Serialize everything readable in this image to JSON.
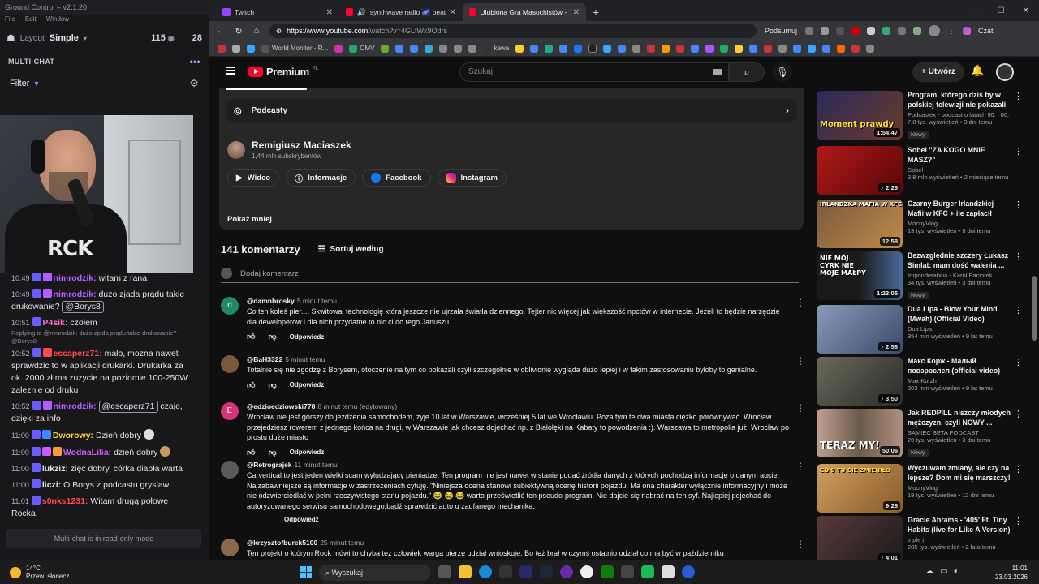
{
  "groundcontrol": {
    "title": "Ground Control – v2.1.20",
    "menu": [
      "File",
      "Edit",
      "Window"
    ],
    "layout_label": "Layout",
    "layout_value": "Simple",
    "viewers": "115",
    "count2": "28",
    "section_title": "MULTI-CHAT",
    "filter_label": "Filter",
    "shirt_text": "RCK",
    "messages": [
      {
        "time": "10:49",
        "nick": "nimrodzik:",
        "nick_color": "#b45cff",
        "text": "witam z rana"
      },
      {
        "time": "10:49",
        "nick": "nimrodzik:",
        "nick_color": "#b45cff",
        "text": "dużo zjada prądu takie drukowanie?",
        "mention": "@Borys8"
      },
      {
        "time": "10:51",
        "nick": "P4sik:",
        "nick_color": "#ff6ad5",
        "text": "czołem",
        "reply": "Replying to @nimrodzik: dużo zjada prądu takie drukowanie? @Borys8"
      },
      {
        "time": "10:52",
        "nick": "escaperz71:",
        "nick_color": "#ff4a4a",
        "text": "mało, mozna nawet sprawdzic to w aplikacji drukarki. Drukarka za ok. 2000 zł ma zuzycie na poziomie 100-250W zaleznie od druku"
      },
      {
        "time": "10:52",
        "nick": "nimrodzik:",
        "nick_color": "#b45cff",
        "mention": "@escaperz71",
        "text": "czaje, dzięki za info"
      },
      {
        "time": "11:00",
        "nick": "Dworowy:",
        "nick_color": "#ffd23f",
        "text": "Dzień dobry"
      },
      {
        "time": "11:00",
        "nick": "WodnaLilia:",
        "nick_color": "#c85cff",
        "text": "dzień dobry"
      },
      {
        "time": "11:00",
        "nick": "lukziz:",
        "nick_color": "#e6e6ea",
        "text": "zięć dobry, córka diabła warta"
      },
      {
        "time": "11:00",
        "nick": "liczi:",
        "nick_color": "#e6e6ea",
        "text": "O Borys z podcastu gryslaw"
      },
      {
        "time": "11:01",
        "nick": "s0nks1231:",
        "nick_color": "#ff4a4a",
        "text": "Witam drugą połowę Rocka."
      }
    ],
    "readonly": "Multi-chat is in read-only mode"
  },
  "browser": {
    "tabs": [
      {
        "title": "Twitch",
        "color": "#9146ff"
      },
      {
        "title": "synthwave radio 🌌 beats to",
        "color": "#ff0033"
      },
      {
        "title": "Ulubiona Gra Masochistów - YouT",
        "color": "#ff0033",
        "active": true
      }
    ],
    "url_host": "https://www.youtube.com",
    "url_path": "/watch?v=4GLtWx9Odrs",
    "summarize": "Podsumuj",
    "chat": "Czat",
    "bookmarks": [
      "World Monitor - R...",
      "OMV",
      "kawa"
    ]
  },
  "youtube": {
    "logo": "Premium",
    "logo_region": "PL",
    "search_placeholder": "Szukaj",
    "create": "Utwórz",
    "podcasts": "Podcasty",
    "channel_name": "Remigiusz Maciaszek",
    "channel_subs": "1,44 mln subskrybentów",
    "chips": [
      {
        "label": "Wideo",
        "icon": "video-icon",
        "color": "#ffffff"
      },
      {
        "label": "Informacje",
        "icon": "info-icon",
        "color": "#ffffff"
      },
      {
        "label": "Facebook",
        "icon": "facebook-icon",
        "color": "#1877f2"
      },
      {
        "label": "Instagram",
        "icon": "instagram-icon",
        "color": "#e1306c"
      }
    ],
    "show_less": "Pokaż mniej",
    "comments_count": "141 komentarzy",
    "sort_label": "Sortuj według",
    "add_comment": "Dodaj komentarz",
    "reply_label": "Odpowiedz",
    "comments": [
      {
        "author": "@damnbrosky",
        "time": "5 minut temu",
        "avatar": "d",
        "avatar_color": "#1e8a6a",
        "text": "Co ten koleś pier.... Skwitował technologię która jeszcze nie ujrzała światła dziennego. Tejter nic więcej jak większość npctów w internecie. Jeżeli to będzie narzędzie dla deweloperów i dla nich przydatne to nic ci do tego Januszu ."
      },
      {
        "author": "@BaH3322",
        "time": "5 minut temu",
        "avatar": "",
        "avatar_color": "#7a5a3a",
        "text": "Totalnie się nie zgodzę z Borysem, otoczenie na tym co pokazali czyli szczegółnie w oblivionie wygląda dużo lepiej i w takim zastosowaniu byłoby to genialne."
      },
      {
        "author": "@edzioedziowski778",
        "time": "8 minut temu (edytowany)",
        "avatar": "E",
        "avatar_color": "#d8327a",
        "text": "Wrocław nie jest gorszy do jeżdżenia samochodem, żyje 10 lat w Warszawie, wcześniej 5 lat we Wrocławiu. Poza tym te dwa miasta ciężko porównywać. Wrocław przejedziesz rowerem z jednego końca na drugi, w Warszawie jak chcesz dojechać np. z Białołęki na Kabaty to powodzenia :). Warszawa to metropolia już, Wrocław po prostu duże miasto"
      },
      {
        "author": "@Retrograjek",
        "time": "11 minut temu",
        "avatar": "",
        "avatar_color": "#5a5a5a",
        "text": "Carvertical to jest jeden wielki scam wyłudzający pieniądze. Ten program nie jest nawet w stanie podać źródła danych z których pochodzą informacje o danym aucie. Najzabawniejsze są informacje w zastrzeżeniach cytuję. \"Niniejsza ocena stanowi subiektywną ocenę historii pojazdu. Ma ona charakter wyłącznie informacyjny i może nie odzwierciedlać w pełni rzeczywistego stanu pojazdu.\" 😂 😂 😂 warto prześwietlić ten pseudo-program. Nie dajcie się nabrać na ten syf. Najlepiej pojechać do autoryzowanego serwisu samochodowego,bądź sprawdzić auto u zaufanego mechanika."
      },
      {
        "author": "@krzysztofburek5100",
        "time": "25 minut temu",
        "avatar": "",
        "avatar_color": "#8a6a4a",
        "text": "Ten projekt o którym Rock mówi to chyba też człowiek warga bierze udział wnioskuje. Bo też brał w czymś ostatnio udział co ma być w październiku"
      }
    ],
    "related": [
      {
        "title": "Program, którego dziś by w polskiej telewizji nie pokazali ...",
        "channel": "Podcastex - podcast o latach 90. i 00.",
        "meta": "7,8 tys. wyświetleń • 3 dni temu",
        "duration": "1:54:47",
        "badge": "Nowy",
        "thumb": "#3a2a5a",
        "cap": "Moment prawdy"
      },
      {
        "title": "Sobel \"ZA KOGO MNIE MASZ?\"",
        "channel": "Sobel",
        "meta": "3,8 mln wyświetleń • 2 miesiące temu",
        "duration": "♪ 2:29",
        "badge": "",
        "thumb": "#8a1010",
        "cap": ""
      },
      {
        "title": "Czarny Burger Irlandzkiej Mafii w KFC + ile zapłacił Szafa za ...",
        "channel": "MocnyVlog",
        "meta": "13 tys. wyświetleń • 9 dni temu",
        "duration": "12:58",
        "badge": "",
        "thumb": "#6a4a2a",
        "cap": "IRLANDZKA MAFIA W KFC"
      },
      {
        "title": "Bezwzględnie szczery Łukasz Simlat: mam dość walenia ...",
        "channel": "Imponderabilia - Karol Paciorek",
        "meta": "34 tys. wyświetleń • 3 dni temu",
        "duration": "1:23:05",
        "badge": "Nowy",
        "thumb": "#2a2a2a",
        "cap": "NIE MÓJ CYRK NIE MOJE MAŁPY"
      },
      {
        "title": "Dua Lipa - Blow Your Mind (Mwah) (Official Video)",
        "channel": "Dua Lipa",
        "meta": "354 mln wyświetleń • 9 lat temu",
        "duration": "♪ 2:58",
        "badge": "",
        "thumb": "#4a5a7a",
        "cap": ""
      },
      {
        "title": "Макс Корж - Малый повзрослел (official video)",
        "channel": "Max Korzh",
        "meta": "203 mln wyświetleń • 9 lat temu",
        "duration": "♪ 3:50",
        "badge": "",
        "thumb": "#4a4a3a",
        "cap": ""
      },
      {
        "title": "Jak REDPILL niszczy młodych mężczyzn, czyli NOWY ...",
        "channel": "SAMIEC BETA PODCAST",
        "meta": "20 tys. wyświetleń • 3 dni temu",
        "duration": "50:06",
        "badge": "Nowy",
        "thumb": "#8a7a6a",
        "cap": "TERAZ MY!"
      },
      {
        "title": "Wyczuwam zmiany, ale czy na lepsze? Dom mi się marszczy!",
        "channel": "MocnyVlog",
        "meta": "19 tys. wyświetleń • 12 dni temu",
        "duration": "9:26",
        "badge": "",
        "thumb": "#9a6a2a",
        "cap": "CO Ś TU SIĘ ZMIENIŁO"
      },
      {
        "title": "Gracie Abrams - '405' Ft. Tiny Habits (live for Like A Version)",
        "channel": "triple j",
        "meta": "285 tys. wyświetleń • 2 lata temu",
        "duration": "♪ 4:01",
        "badge": "",
        "thumb": "#3a2a2a",
        "cap": ""
      }
    ]
  },
  "taskbar": {
    "temp": "14°C",
    "weather": "Przew. słonecz.",
    "search": "Wyszukaj",
    "time": "11:01",
    "date": "23.03.2026"
  }
}
